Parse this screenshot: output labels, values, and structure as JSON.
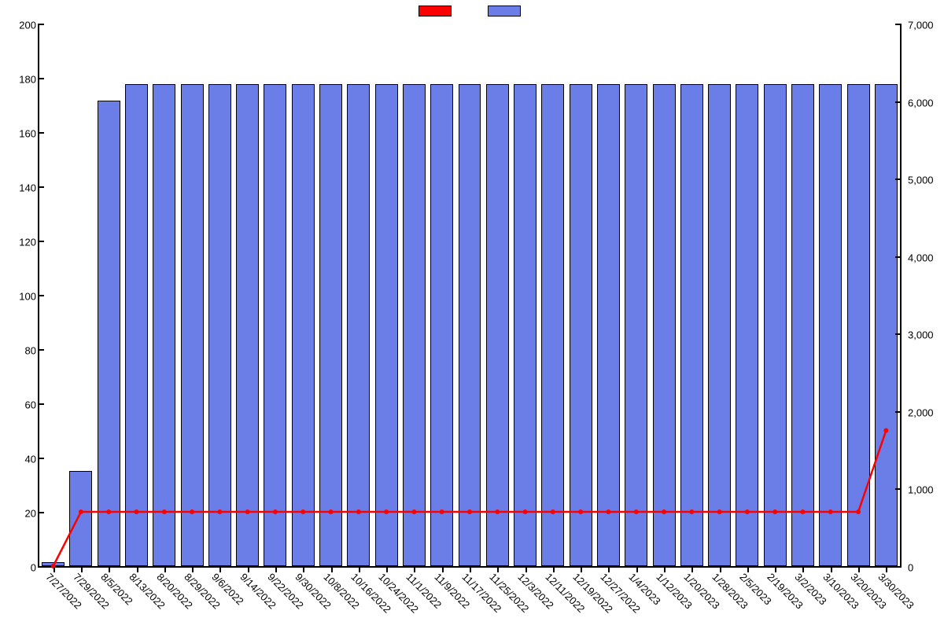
{
  "chart_data": {
    "type": "bar+line",
    "categories": [
      "7/27/2022",
      "7/29/2022",
      "8/5/2022",
      "8/13/2022",
      "8/20/2022",
      "8/29/2022",
      "9/6/2022",
      "9/14/2022",
      "9/22/2022",
      "9/30/2022",
      "10/8/2022",
      "10/16/2022",
      "10/24/2022",
      "11/1/2022",
      "11/9/2022",
      "11/17/2022",
      "11/25/2022",
      "12/3/2022",
      "12/11/2022",
      "12/19/2022",
      "12/27/2022",
      "1/4/2023",
      "1/12/2023",
      "1/20/2023",
      "1/28/2023",
      "2/5/2023",
      "2/19/2023",
      "3/2/2023",
      "3/10/2023",
      "3/20/2023",
      "3/30/2023"
    ],
    "series": [
      {
        "name": "",
        "kind": "line",
        "axis": "left",
        "color": "#ff0000",
        "values": [
          0,
          20,
          20,
          20,
          20,
          20,
          20,
          20,
          20,
          20,
          20,
          20,
          20,
          20,
          20,
          20,
          20,
          20,
          20,
          20,
          20,
          20,
          20,
          20,
          20,
          20,
          20,
          20,
          20,
          20,
          50
        ]
      },
      {
        "name": "",
        "kind": "bar",
        "axis": "right",
        "color": "#6b7ee8",
        "values": [
          50,
          1230,
          6010,
          6220,
          6220,
          6220,
          6220,
          6220,
          6220,
          6220,
          6220,
          6220,
          6220,
          6220,
          6220,
          6220,
          6220,
          6220,
          6220,
          6220,
          6220,
          6220,
          6220,
          6220,
          6220,
          6220,
          6220,
          6220,
          6220,
          6220,
          6220
        ]
      }
    ],
    "left_axis": {
      "min": 0,
      "max": 200,
      "ticks": [
        0,
        20,
        40,
        60,
        80,
        100,
        120,
        140,
        160,
        180,
        200
      ]
    },
    "right_axis": {
      "min": 0,
      "max": 7000,
      "ticks": [
        0,
        1000,
        2000,
        3000,
        4000,
        5000,
        6000,
        7000
      ],
      "tick_labels": [
        "0",
        "1,000",
        "2,000",
        "3,000",
        "4,000",
        "5,000",
        "6,000",
        "7,000"
      ]
    },
    "title": "",
    "xlabel": "",
    "ylabel": ""
  }
}
